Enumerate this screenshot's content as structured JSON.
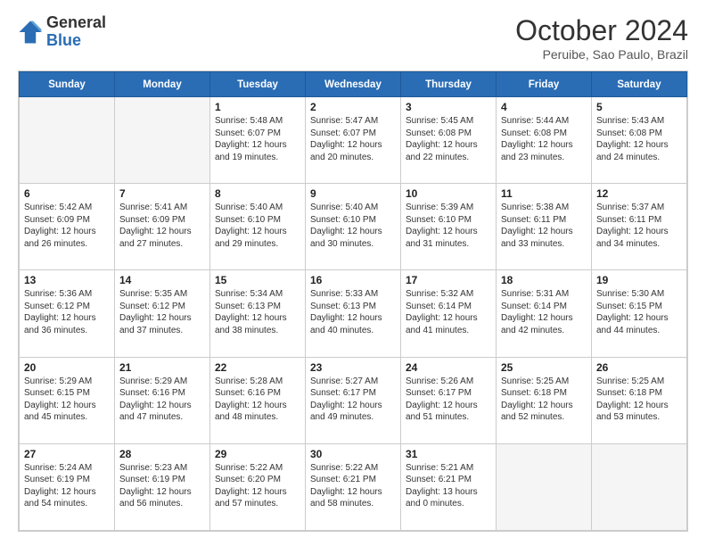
{
  "header": {
    "logo_general": "General",
    "logo_blue": "Blue",
    "month": "October 2024",
    "location": "Peruibe, Sao Paulo, Brazil"
  },
  "days_of_week": [
    "Sunday",
    "Monday",
    "Tuesday",
    "Wednesday",
    "Thursday",
    "Friday",
    "Saturday"
  ],
  "weeks": [
    [
      {
        "date": "",
        "empty": true
      },
      {
        "date": "",
        "empty": true
      },
      {
        "date": "1",
        "sunrise": "Sunrise: 5:48 AM",
        "sunset": "Sunset: 6:07 PM",
        "daylight": "Daylight: 12 hours and 19 minutes."
      },
      {
        "date": "2",
        "sunrise": "Sunrise: 5:47 AM",
        "sunset": "Sunset: 6:07 PM",
        "daylight": "Daylight: 12 hours and 20 minutes."
      },
      {
        "date": "3",
        "sunrise": "Sunrise: 5:45 AM",
        "sunset": "Sunset: 6:08 PM",
        "daylight": "Daylight: 12 hours and 22 minutes."
      },
      {
        "date": "4",
        "sunrise": "Sunrise: 5:44 AM",
        "sunset": "Sunset: 6:08 PM",
        "daylight": "Daylight: 12 hours and 23 minutes."
      },
      {
        "date": "5",
        "sunrise": "Sunrise: 5:43 AM",
        "sunset": "Sunset: 6:08 PM",
        "daylight": "Daylight: 12 hours and 24 minutes."
      }
    ],
    [
      {
        "date": "6",
        "sunrise": "Sunrise: 5:42 AM",
        "sunset": "Sunset: 6:09 PM",
        "daylight": "Daylight: 12 hours and 26 minutes."
      },
      {
        "date": "7",
        "sunrise": "Sunrise: 5:41 AM",
        "sunset": "Sunset: 6:09 PM",
        "daylight": "Daylight: 12 hours and 27 minutes."
      },
      {
        "date": "8",
        "sunrise": "Sunrise: 5:40 AM",
        "sunset": "Sunset: 6:10 PM",
        "daylight": "Daylight: 12 hours and 29 minutes."
      },
      {
        "date": "9",
        "sunrise": "Sunrise: 5:40 AM",
        "sunset": "Sunset: 6:10 PM",
        "daylight": "Daylight: 12 hours and 30 minutes."
      },
      {
        "date": "10",
        "sunrise": "Sunrise: 5:39 AM",
        "sunset": "Sunset: 6:10 PM",
        "daylight": "Daylight: 12 hours and 31 minutes."
      },
      {
        "date": "11",
        "sunrise": "Sunrise: 5:38 AM",
        "sunset": "Sunset: 6:11 PM",
        "daylight": "Daylight: 12 hours and 33 minutes."
      },
      {
        "date": "12",
        "sunrise": "Sunrise: 5:37 AM",
        "sunset": "Sunset: 6:11 PM",
        "daylight": "Daylight: 12 hours and 34 minutes."
      }
    ],
    [
      {
        "date": "13",
        "sunrise": "Sunrise: 5:36 AM",
        "sunset": "Sunset: 6:12 PM",
        "daylight": "Daylight: 12 hours and 36 minutes."
      },
      {
        "date": "14",
        "sunrise": "Sunrise: 5:35 AM",
        "sunset": "Sunset: 6:12 PM",
        "daylight": "Daylight: 12 hours and 37 minutes."
      },
      {
        "date": "15",
        "sunrise": "Sunrise: 5:34 AM",
        "sunset": "Sunset: 6:13 PM",
        "daylight": "Daylight: 12 hours and 38 minutes."
      },
      {
        "date": "16",
        "sunrise": "Sunrise: 5:33 AM",
        "sunset": "Sunset: 6:13 PM",
        "daylight": "Daylight: 12 hours and 40 minutes."
      },
      {
        "date": "17",
        "sunrise": "Sunrise: 5:32 AM",
        "sunset": "Sunset: 6:14 PM",
        "daylight": "Daylight: 12 hours and 41 minutes."
      },
      {
        "date": "18",
        "sunrise": "Sunrise: 5:31 AM",
        "sunset": "Sunset: 6:14 PM",
        "daylight": "Daylight: 12 hours and 42 minutes."
      },
      {
        "date": "19",
        "sunrise": "Sunrise: 5:30 AM",
        "sunset": "Sunset: 6:15 PM",
        "daylight": "Daylight: 12 hours and 44 minutes."
      }
    ],
    [
      {
        "date": "20",
        "sunrise": "Sunrise: 5:29 AM",
        "sunset": "Sunset: 6:15 PM",
        "daylight": "Daylight: 12 hours and 45 minutes."
      },
      {
        "date": "21",
        "sunrise": "Sunrise: 5:29 AM",
        "sunset": "Sunset: 6:16 PM",
        "daylight": "Daylight: 12 hours and 47 minutes."
      },
      {
        "date": "22",
        "sunrise": "Sunrise: 5:28 AM",
        "sunset": "Sunset: 6:16 PM",
        "daylight": "Daylight: 12 hours and 48 minutes."
      },
      {
        "date": "23",
        "sunrise": "Sunrise: 5:27 AM",
        "sunset": "Sunset: 6:17 PM",
        "daylight": "Daylight: 12 hours and 49 minutes."
      },
      {
        "date": "24",
        "sunrise": "Sunrise: 5:26 AM",
        "sunset": "Sunset: 6:17 PM",
        "daylight": "Daylight: 12 hours and 51 minutes."
      },
      {
        "date": "25",
        "sunrise": "Sunrise: 5:25 AM",
        "sunset": "Sunset: 6:18 PM",
        "daylight": "Daylight: 12 hours and 52 minutes."
      },
      {
        "date": "26",
        "sunrise": "Sunrise: 5:25 AM",
        "sunset": "Sunset: 6:18 PM",
        "daylight": "Daylight: 12 hours and 53 minutes."
      }
    ],
    [
      {
        "date": "27",
        "sunrise": "Sunrise: 5:24 AM",
        "sunset": "Sunset: 6:19 PM",
        "daylight": "Daylight: 12 hours and 54 minutes."
      },
      {
        "date": "28",
        "sunrise": "Sunrise: 5:23 AM",
        "sunset": "Sunset: 6:19 PM",
        "daylight": "Daylight: 12 hours and 56 minutes."
      },
      {
        "date": "29",
        "sunrise": "Sunrise: 5:22 AM",
        "sunset": "Sunset: 6:20 PM",
        "daylight": "Daylight: 12 hours and 57 minutes."
      },
      {
        "date": "30",
        "sunrise": "Sunrise: 5:22 AM",
        "sunset": "Sunset: 6:21 PM",
        "daylight": "Daylight: 12 hours and 58 minutes."
      },
      {
        "date": "31",
        "sunrise": "Sunrise: 5:21 AM",
        "sunset": "Sunset: 6:21 PM",
        "daylight": "Daylight: 13 hours and 0 minutes."
      },
      {
        "date": "",
        "empty": true
      },
      {
        "date": "",
        "empty": true
      }
    ]
  ]
}
